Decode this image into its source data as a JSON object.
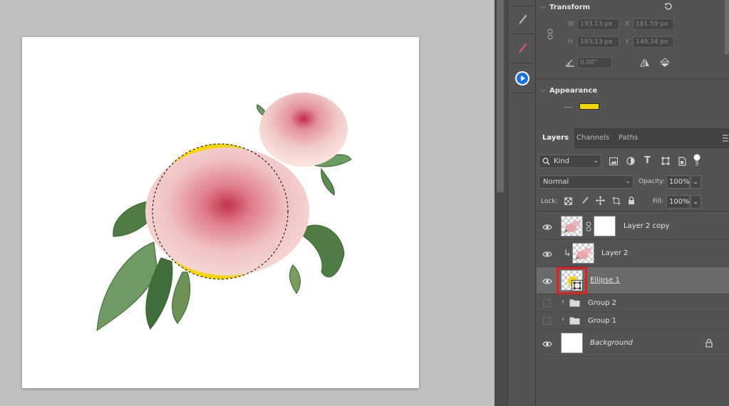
{
  "transform": {
    "title": "Transform",
    "w_label": "W",
    "w_value": "193.13 px",
    "h_label": "H",
    "h_value": "193.13 px",
    "x_label": "X",
    "x_value": "181.59 px",
    "y_label": "Y",
    "y_value": "149.34 px",
    "angle_value": "0.00°"
  },
  "appearance": {
    "title": "Appearance",
    "fill_color": "#f5d400"
  },
  "layers_panel": {
    "tabs": [
      "Layers",
      "Channels",
      "Paths"
    ],
    "filter_kind": "Kind",
    "blend_mode": "Normal",
    "opacity_label": "Opacity:",
    "opacity_value": "100%",
    "lock_label": "Lock:",
    "fill_label": "Fill:",
    "fill_value": "100%",
    "layers": [
      {
        "name": "Layer 2 copy",
        "visible": true
      },
      {
        "name": "Layer 2",
        "visible": true,
        "clipped": true
      },
      {
        "name": "Ellipse 1",
        "visible": true,
        "selected": true
      },
      {
        "name": "Group 2",
        "visible": false,
        "group": true
      },
      {
        "name": "Group 1",
        "visible": false,
        "group": true
      },
      {
        "name": "Background",
        "visible": true,
        "locked": true
      }
    ]
  },
  "colors": {
    "canvas_bg": "#bfbfbf",
    "panel_bg": "#535353",
    "ellipse_fill": "#f5d400",
    "selection_highlight": "#e02020",
    "accent_blue": "#1473e6"
  },
  "icons": [
    "brush-icon",
    "color-brush-icon",
    "play-icon",
    "reset-icon",
    "link-icon",
    "angle-icon",
    "flip-horizontal-icon",
    "flip-vertical-icon",
    "search-icon",
    "image-filter-icon",
    "adjustment-filter-icon",
    "type-filter-icon",
    "shape-filter-icon",
    "smart-object-filter-icon",
    "filter-toggle-icon",
    "lock-pixels-icon",
    "lock-paint-icon",
    "lock-move-icon",
    "lock-artboard-icon",
    "lock-all-icon",
    "eye-icon",
    "chain-icon",
    "folder-icon",
    "chevron-right-icon",
    "lock-icon",
    "panel-menu-icon"
  ]
}
